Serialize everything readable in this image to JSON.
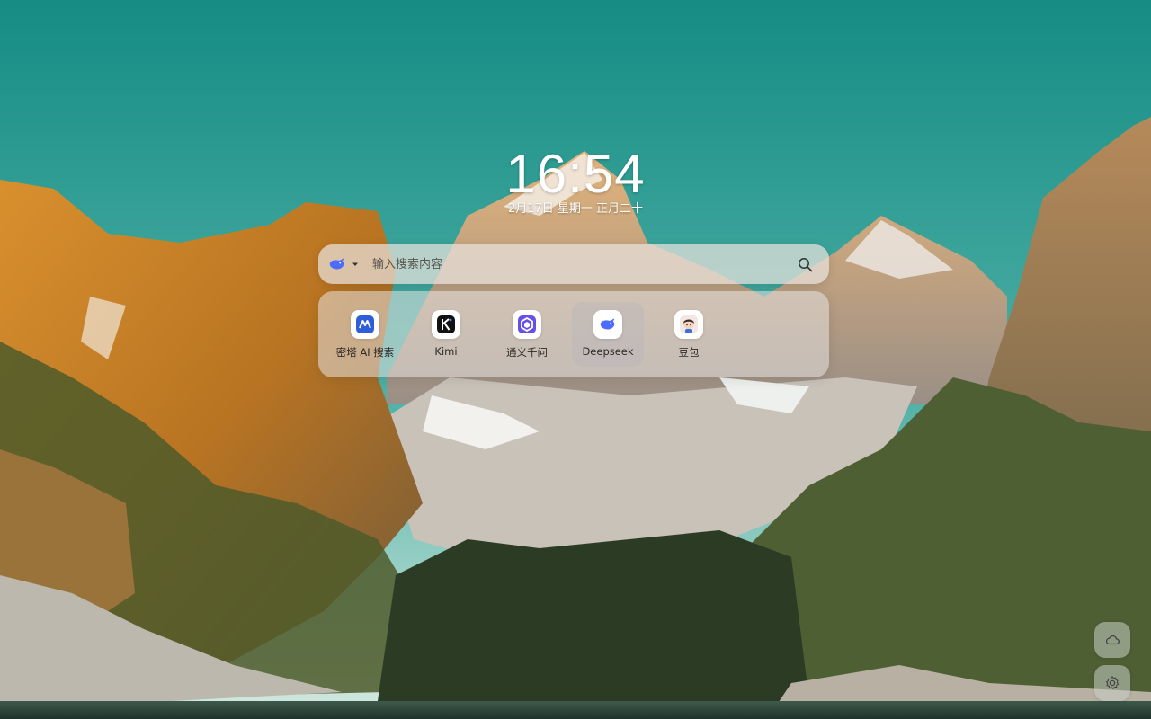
{
  "clock": {
    "time": "16:54",
    "date": "2月17日 星期一 正月二十"
  },
  "search": {
    "engine_icon": "deepseek-whale-icon",
    "placeholder": "输入搜索内容",
    "button_icon": "search-icon"
  },
  "shortcuts": [
    {
      "label": "密塔 AI 搜索",
      "icon": "metaso-icon"
    },
    {
      "label": "Kimi",
      "icon": "kimi-icon"
    },
    {
      "label": "通义千问",
      "icon": "tongyi-icon"
    },
    {
      "label": "Deepseek",
      "icon": "deepseek-icon",
      "active": true
    },
    {
      "label": "豆包",
      "icon": "doubao-icon"
    }
  ],
  "corner_buttons": [
    {
      "icon": "cloud-icon"
    },
    {
      "icon": "gear-icon"
    }
  ],
  "colors": {
    "sky_top": "#1a8d85",
    "sky_horizon": "#c9e3dc",
    "accent_blue": "#4d6bfe"
  }
}
